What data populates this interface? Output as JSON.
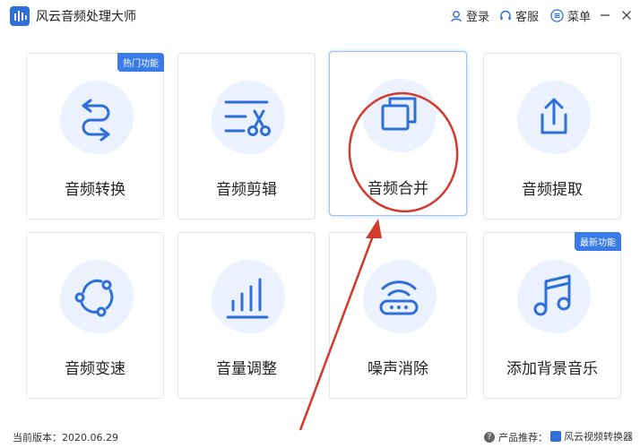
{
  "app": {
    "title": "风云音频处理大师",
    "colors": {
      "accent": "#3a7bea",
      "icon": "#2f6fd8",
      "blob": "#ebf2fd",
      "annotation": "#d33a2c"
    }
  },
  "titlebar": {
    "login": "登录",
    "service": "客服",
    "menu": "菜单"
  },
  "cards": [
    {
      "label": "音频转换",
      "icon": "convert-arrows-icon",
      "badge": "热门功能"
    },
    {
      "label": "音频剪辑",
      "icon": "scissors-lines-icon",
      "badge": ""
    },
    {
      "label": "音频合并",
      "icon": "overlap-squares-icon",
      "badge": "",
      "selected": true
    },
    {
      "label": "音频提取",
      "icon": "upload-tray-icon",
      "badge": ""
    },
    {
      "label": "音频变速",
      "icon": "rotate-dots-icon",
      "badge": ""
    },
    {
      "label": "音量调整",
      "icon": "volume-bars-icon",
      "badge": ""
    },
    {
      "label": "噪声消除",
      "icon": "wifi-device-icon",
      "badge": ""
    },
    {
      "label": "添加背景音乐",
      "icon": "music-note-icon",
      "badge": "最新功能"
    }
  ],
  "status": {
    "version": "当前版本：2020.06.29",
    "recommend": "产品推荐：",
    "product": "风云视频转换器"
  }
}
